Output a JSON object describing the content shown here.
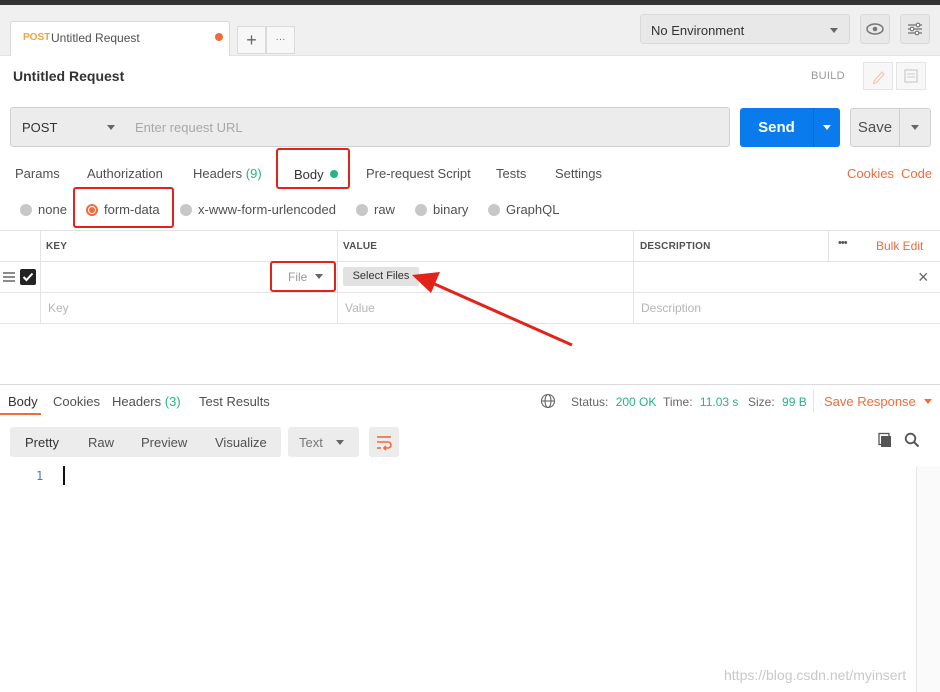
{
  "tab": {
    "method": "POST",
    "title": "Untitled Request",
    "new_tab": "+",
    "more": "···"
  },
  "environment": {
    "selected": "No Environment"
  },
  "request": {
    "title": "Untitled Request",
    "build_label": "BUILD",
    "method": "POST",
    "url_placeholder": "Enter request URL",
    "send_label": "Send",
    "save_label": "Save"
  },
  "request_tabs": {
    "params": "Params",
    "authorization": "Authorization",
    "headers": "Headers",
    "headers_count": "(9)",
    "body": "Body",
    "pre_request": "Pre-request Script",
    "tests": "Tests",
    "settings": "Settings",
    "cookies": "Cookies",
    "code": "Code"
  },
  "body_types": {
    "none": "none",
    "form_data": "form-data",
    "urlencoded": "x-www-form-urlencoded",
    "raw": "raw",
    "binary": "binary",
    "graphql": "GraphQL"
  },
  "kv_table": {
    "key_header": "KEY",
    "value_header": "VALUE",
    "description_header": "DESCRIPTION",
    "more": "•••",
    "bulk_edit": "Bulk Edit",
    "row1": {
      "type": "File",
      "select_files": "Select Files",
      "remove": "×"
    },
    "placeholder_row": {
      "key": "Key",
      "value": "Value",
      "description": "Description"
    }
  },
  "response": {
    "tabs": {
      "body": "Body",
      "cookies": "Cookies",
      "headers": "Headers",
      "headers_count": "(3)",
      "test_results": "Test Results"
    },
    "status_label": "Status:",
    "status_value": "200 OK",
    "time_label": "Time:",
    "time_value": "11.03 s",
    "size_label": "Size:",
    "size_value": "99 B",
    "save_response": "Save Response",
    "formats": {
      "pretty": "Pretty",
      "raw": "Raw",
      "preview": "Preview",
      "visualize": "Visualize"
    },
    "text_type": "Text",
    "line_number": "1"
  },
  "watermark": "https://blog.csdn.net/myinsert",
  "colors": {
    "accent": "#f26b3a",
    "send": "#097bed",
    "success": "#26b47f",
    "highlight": "#e2231a"
  }
}
